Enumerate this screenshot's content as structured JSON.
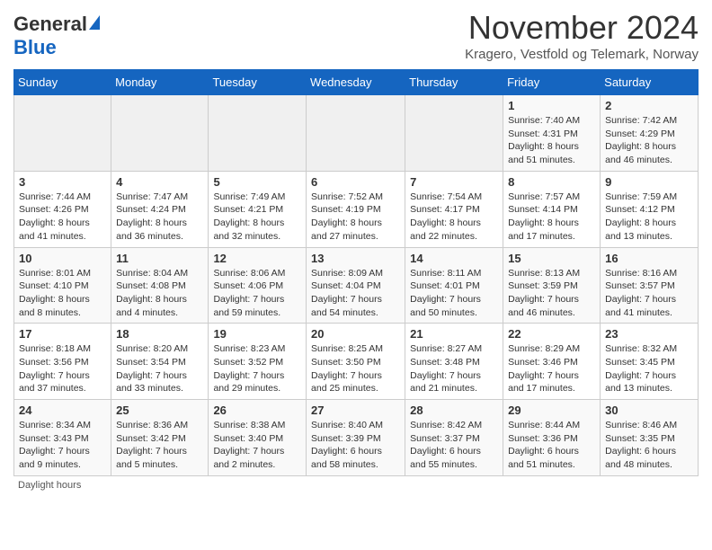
{
  "header": {
    "logo_line1": "General",
    "logo_line2": "Blue",
    "month_title": "November 2024",
    "subtitle": "Kragero, Vestfold og Telemark, Norway"
  },
  "weekdays": [
    "Sunday",
    "Monday",
    "Tuesday",
    "Wednesday",
    "Thursday",
    "Friday",
    "Saturday"
  ],
  "weeks": [
    [
      {
        "day": "",
        "info": ""
      },
      {
        "day": "",
        "info": ""
      },
      {
        "day": "",
        "info": ""
      },
      {
        "day": "",
        "info": ""
      },
      {
        "day": "",
        "info": ""
      },
      {
        "day": "1",
        "info": "Sunrise: 7:40 AM\nSunset: 4:31 PM\nDaylight: 8 hours and 51 minutes."
      },
      {
        "day": "2",
        "info": "Sunrise: 7:42 AM\nSunset: 4:29 PM\nDaylight: 8 hours and 46 minutes."
      }
    ],
    [
      {
        "day": "3",
        "info": "Sunrise: 7:44 AM\nSunset: 4:26 PM\nDaylight: 8 hours and 41 minutes."
      },
      {
        "day": "4",
        "info": "Sunrise: 7:47 AM\nSunset: 4:24 PM\nDaylight: 8 hours and 36 minutes."
      },
      {
        "day": "5",
        "info": "Sunrise: 7:49 AM\nSunset: 4:21 PM\nDaylight: 8 hours and 32 minutes."
      },
      {
        "day": "6",
        "info": "Sunrise: 7:52 AM\nSunset: 4:19 PM\nDaylight: 8 hours and 27 minutes."
      },
      {
        "day": "7",
        "info": "Sunrise: 7:54 AM\nSunset: 4:17 PM\nDaylight: 8 hours and 22 minutes."
      },
      {
        "day": "8",
        "info": "Sunrise: 7:57 AM\nSunset: 4:14 PM\nDaylight: 8 hours and 17 minutes."
      },
      {
        "day": "9",
        "info": "Sunrise: 7:59 AM\nSunset: 4:12 PM\nDaylight: 8 hours and 13 minutes."
      }
    ],
    [
      {
        "day": "10",
        "info": "Sunrise: 8:01 AM\nSunset: 4:10 PM\nDaylight: 8 hours and 8 minutes."
      },
      {
        "day": "11",
        "info": "Sunrise: 8:04 AM\nSunset: 4:08 PM\nDaylight: 8 hours and 4 minutes."
      },
      {
        "day": "12",
        "info": "Sunrise: 8:06 AM\nSunset: 4:06 PM\nDaylight: 7 hours and 59 minutes."
      },
      {
        "day": "13",
        "info": "Sunrise: 8:09 AM\nSunset: 4:04 PM\nDaylight: 7 hours and 54 minutes."
      },
      {
        "day": "14",
        "info": "Sunrise: 8:11 AM\nSunset: 4:01 PM\nDaylight: 7 hours and 50 minutes."
      },
      {
        "day": "15",
        "info": "Sunrise: 8:13 AM\nSunset: 3:59 PM\nDaylight: 7 hours and 46 minutes."
      },
      {
        "day": "16",
        "info": "Sunrise: 8:16 AM\nSunset: 3:57 PM\nDaylight: 7 hours and 41 minutes."
      }
    ],
    [
      {
        "day": "17",
        "info": "Sunrise: 8:18 AM\nSunset: 3:56 PM\nDaylight: 7 hours and 37 minutes."
      },
      {
        "day": "18",
        "info": "Sunrise: 8:20 AM\nSunset: 3:54 PM\nDaylight: 7 hours and 33 minutes."
      },
      {
        "day": "19",
        "info": "Sunrise: 8:23 AM\nSunset: 3:52 PM\nDaylight: 7 hours and 29 minutes."
      },
      {
        "day": "20",
        "info": "Sunrise: 8:25 AM\nSunset: 3:50 PM\nDaylight: 7 hours and 25 minutes."
      },
      {
        "day": "21",
        "info": "Sunrise: 8:27 AM\nSunset: 3:48 PM\nDaylight: 7 hours and 21 minutes."
      },
      {
        "day": "22",
        "info": "Sunrise: 8:29 AM\nSunset: 3:46 PM\nDaylight: 7 hours and 17 minutes."
      },
      {
        "day": "23",
        "info": "Sunrise: 8:32 AM\nSunset: 3:45 PM\nDaylight: 7 hours and 13 minutes."
      }
    ],
    [
      {
        "day": "24",
        "info": "Sunrise: 8:34 AM\nSunset: 3:43 PM\nDaylight: 7 hours and 9 minutes."
      },
      {
        "day": "25",
        "info": "Sunrise: 8:36 AM\nSunset: 3:42 PM\nDaylight: 7 hours and 5 minutes."
      },
      {
        "day": "26",
        "info": "Sunrise: 8:38 AM\nSunset: 3:40 PM\nDaylight: 7 hours and 2 minutes."
      },
      {
        "day": "27",
        "info": "Sunrise: 8:40 AM\nSunset: 3:39 PM\nDaylight: 6 hours and 58 minutes."
      },
      {
        "day": "28",
        "info": "Sunrise: 8:42 AM\nSunset: 3:37 PM\nDaylight: 6 hours and 55 minutes."
      },
      {
        "day": "29",
        "info": "Sunrise: 8:44 AM\nSunset: 3:36 PM\nDaylight: 6 hours and 51 minutes."
      },
      {
        "day": "30",
        "info": "Sunrise: 8:46 AM\nSunset: 3:35 PM\nDaylight: 6 hours and 48 minutes."
      }
    ]
  ],
  "footer": {
    "daylight_label": "Daylight hours"
  }
}
